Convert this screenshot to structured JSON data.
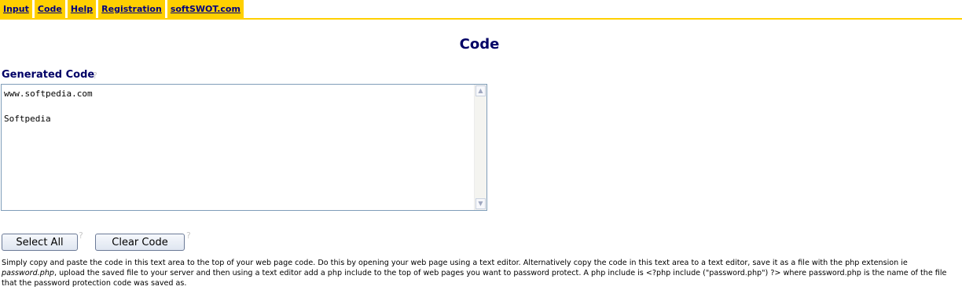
{
  "nav": {
    "items": [
      {
        "label": "Input"
      },
      {
        "label": "Code"
      },
      {
        "label": "Help"
      },
      {
        "label": "Registration"
      },
      {
        "label": "softSWOT.com"
      }
    ]
  },
  "page": {
    "title": "Code",
    "section_label": "Generated Code",
    "help_mark": "?"
  },
  "code_area": {
    "value": "www.softpedia.com\n\nSoftpedia"
  },
  "buttons": {
    "select_all": "Select All",
    "clear_code": "Clear Code"
  },
  "instructions": {
    "part1": "Simply copy and paste the code in this text area to the top of your web page code. Do this by opening your web page using a text editor. Alternatively copy the code in this text area to a text editor, save it as a file with the php extension ie ",
    "filename": "password.php",
    "part2": ", upload the saved file to your server and then using a text editor add a php include to the top of web pages you want to password protect. A php include is <?php include (\"password.php\") ?> where password.php is the name of the file that the password protection code was saved as."
  },
  "colors": {
    "nav_bg": "#ffd000",
    "nav_text": "#000080",
    "heading": "#000066",
    "button_border": "#6b7a97"
  }
}
